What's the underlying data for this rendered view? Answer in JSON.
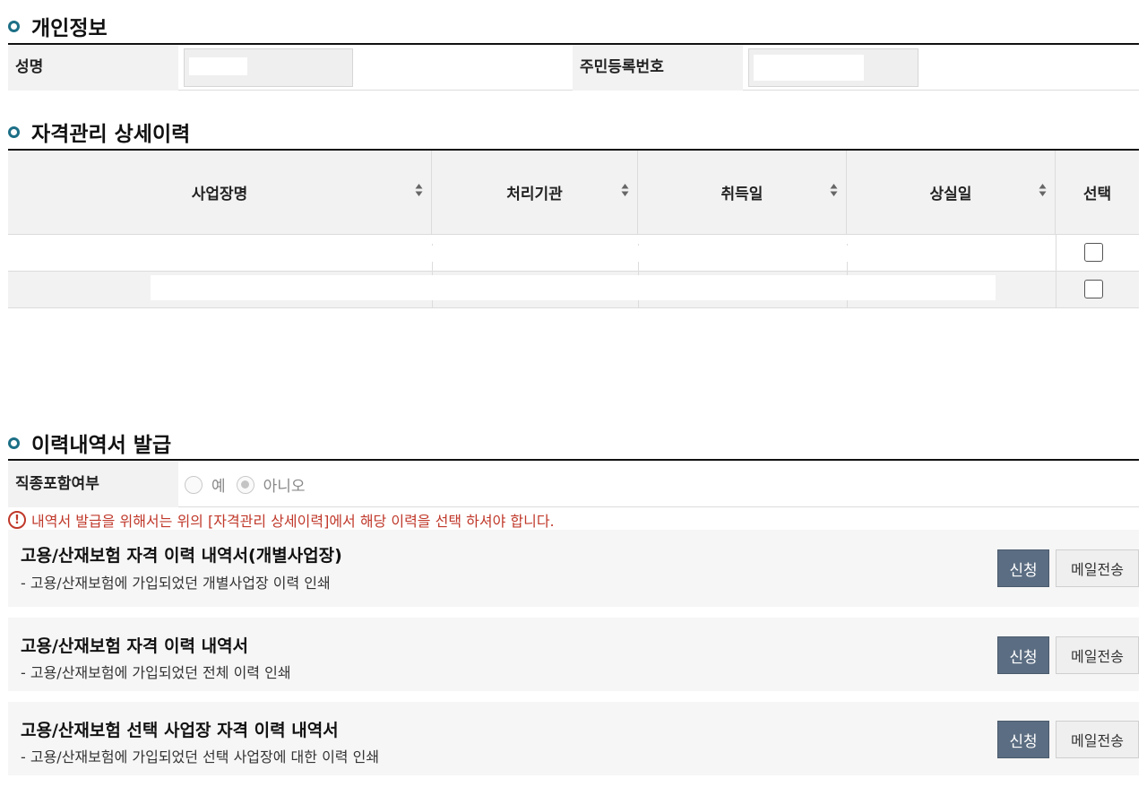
{
  "personal": {
    "title": "개인정보",
    "name_label": "성명",
    "resident_label": "주민등록번호"
  },
  "history": {
    "title": "자격관리 상세이력",
    "columns": [
      "사업장명",
      "처리기관",
      "취득일",
      "상실일",
      "선택"
    ]
  },
  "issue": {
    "title": "이력내역서 발급",
    "job_label": "직종포함여부",
    "options": [
      "예",
      "아니오"
    ],
    "selected": "아니오",
    "notice_icon": "!",
    "notice": "내역서 발급을 위해서는 위의 [자격관리 상세이력]에서 해당 이력을 선택 하셔야 합니다.",
    "documents": [
      {
        "title": "고용/산재보험 자격 이력 내역서(개별사업장)",
        "desc": "- 고용/산재보험에 가입되었던 개별사업장 이력 인쇄",
        "apply": "신청",
        "mail": "메일전송"
      },
      {
        "title": "고용/산재보험 자격 이력 내역서",
        "desc": "- 고용/산재보험에 가입되었던 전체 이력 인쇄",
        "apply": "신청",
        "mail": "메일전송"
      },
      {
        "title": "고용/산재보험 선택 사업장 자격 이력 내역서",
        "desc": "- 고용/산재보험에 가입되었던 선택 사업장에 대한 이력 인쇄",
        "apply": "신청",
        "mail": "메일전송"
      }
    ]
  },
  "colors": {
    "accent": "#1c6f86",
    "button": "#5b6d82",
    "notice": "#c0392b"
  }
}
